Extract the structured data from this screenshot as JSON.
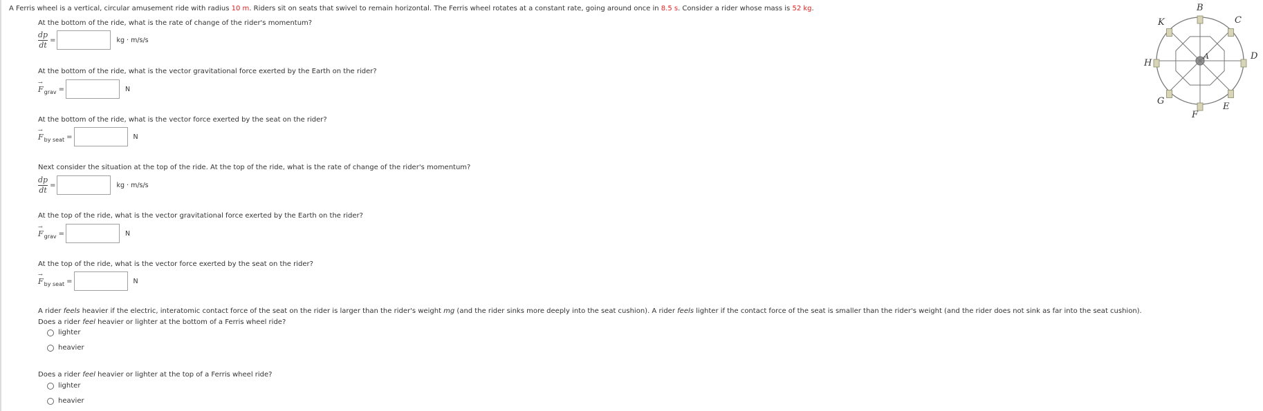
{
  "intro": {
    "part1": "A Ferris wheel is a vertical, circular amusement ride with radius ",
    "radius": "10 m",
    "part2": ". Riders sit on seats that swivel to remain horizontal. The Ferris wheel rotates at a constant rate, going around once in ",
    "period": "8.5 s",
    "part3": ". Consider a rider whose mass is ",
    "mass": "52 kg",
    "part4": "."
  },
  "questions": [
    {
      "text": "At the bottom of the ride, what is the rate of change of the rider's momentum?",
      "unit": "kg · m/s/s"
    },
    {
      "text": "At the bottom of the ride, what is the vector gravitational force exerted by the Earth on the rider?",
      "sub": "grav",
      "unit": "N"
    },
    {
      "text": "At the bottom of the ride, what is the vector force exerted by the seat on the rider?",
      "sub": "by seat",
      "unit": "N"
    },
    {
      "text": "Next consider the situation at the top of the ride. At the top of the ride, what is the rate of change of the rider's momentum?",
      "unit": "kg · m/s/s"
    },
    {
      "text": "At the top of the ride, what is the vector gravitational force exerted by the Earth on the rider?",
      "sub": "grav",
      "unit": "N"
    },
    {
      "text": "At the top of the ride, what is the vector force exerted by the seat on the rider?",
      "sub": "by seat",
      "unit": "N"
    }
  ],
  "deriv": {
    "top": "dp",
    "bottom": "dt",
    "eq": "="
  },
  "feels_text": {
    "a": "A rider ",
    "feels1": "feels",
    "b": " heavier if the electric, interatomic contact force of the seat on the rider is larger than the rider's weight ",
    "mg": "mg",
    "c": " (and the rider sinks more deeply into the seat cushion). A rider ",
    "feels2": "feels",
    "d": " lighter if the contact force of the seat is smaller than the rider's weight (and the rider does not sink as far into the seat cushion)."
  },
  "q7": {
    "pre": "Does a rider ",
    "feel": "feel",
    "post": " heavier or lighter at the bottom of a Ferris wheel ride?",
    "options": [
      "lighter",
      "heavier"
    ]
  },
  "q8": {
    "pre": "Does a rider ",
    "feel": "feel",
    "post": " heavier or lighter at the top of a Ferris wheel ride?",
    "options": [
      "lighter",
      "heavier"
    ]
  },
  "figure": {
    "labels": {
      "A": "A",
      "B": "B",
      "C": "C",
      "D": "D",
      "E": "E",
      "F": "F",
      "G": "G",
      "H": "H",
      "K": "K"
    },
    "colors": {
      "wheel": "#777777",
      "seat": "#8a8a6a"
    }
  }
}
